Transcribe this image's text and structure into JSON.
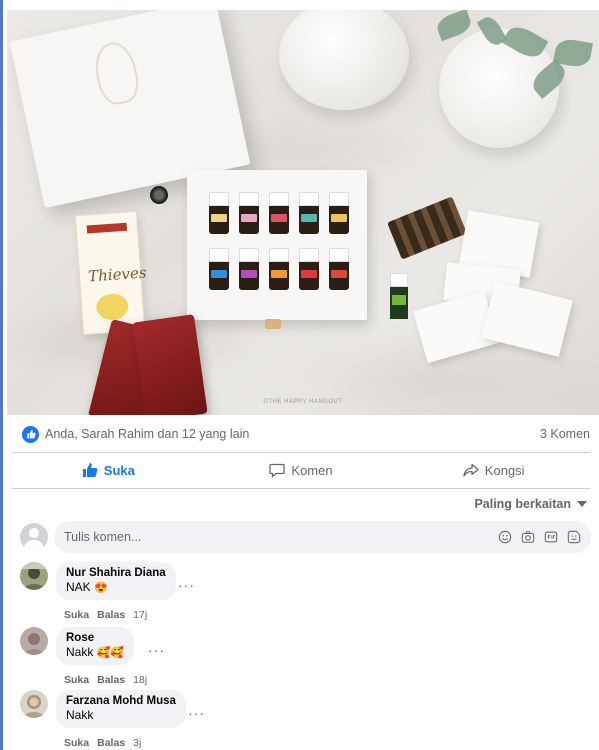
{
  "post": {
    "photo_watermark": "©THE HAPPY HANGOUT",
    "product_text": "Thieves",
    "reactions_text": "Anda, Sarah Rahim dan 12 yang lain",
    "comments_count": "3 Komen"
  },
  "actions": {
    "like_label": "Suka",
    "comment_label": "Komen",
    "share_label": "Kongsi"
  },
  "sort": {
    "label": "Paling berkaitan"
  },
  "composer": {
    "placeholder": "Tulis komen..."
  },
  "comments": [
    {
      "name": "Nur Shahira Diana",
      "text": "NAK",
      "emoji": "😍",
      "like": "Suka",
      "reply": "Balas",
      "time": "17j"
    },
    {
      "name": "Rose",
      "text": "Nakk",
      "emoji": "🥰🥰",
      "like": "Suka",
      "reply": "Balas",
      "time": "18j"
    },
    {
      "name": "Farzana Mohd Musa",
      "text": "Nakk",
      "emoji": "",
      "like": "Suka",
      "reply": "Balas",
      "time": "3j"
    }
  ],
  "colors": {
    "accent": "#1877f2",
    "muted": "#65676b",
    "bubble": "#f0f2f5"
  },
  "icons": [
    "like-icon",
    "comment-icon",
    "share-icon",
    "emoji-icon",
    "camera-icon",
    "gif-icon",
    "sticker-icon",
    "more-icon",
    "caret-down-icon"
  ]
}
